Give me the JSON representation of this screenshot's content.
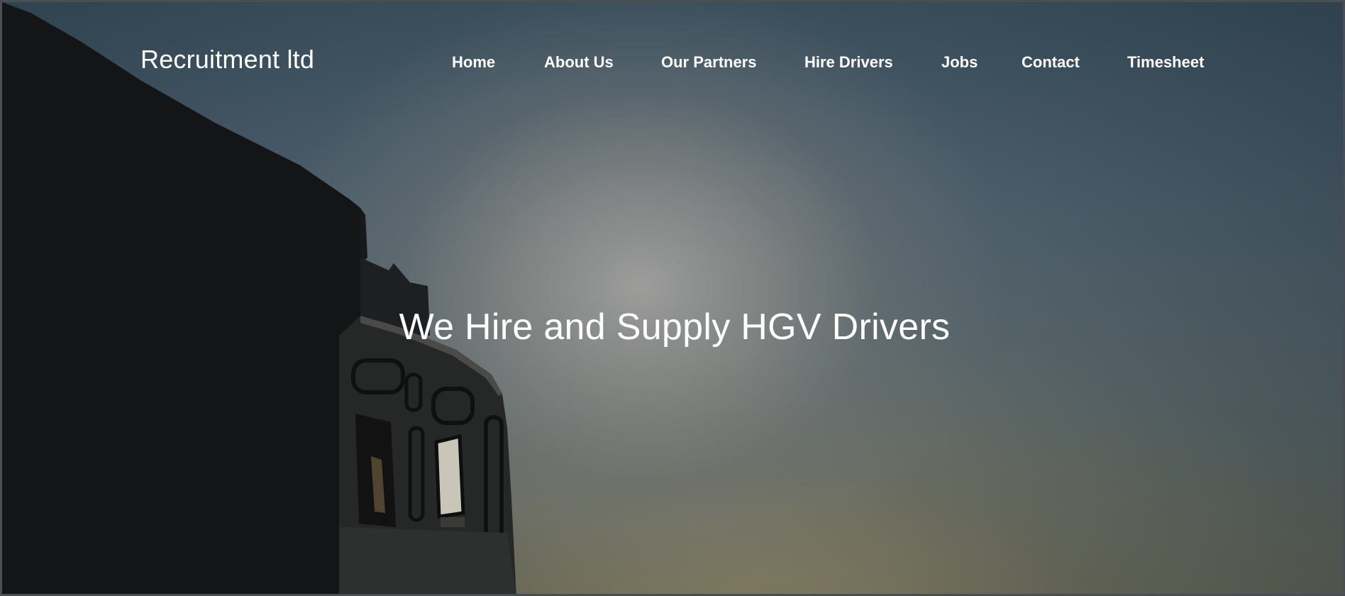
{
  "header": {
    "brand": "Recruitment ltd",
    "nav": [
      {
        "label": "Home"
      },
      {
        "label": "About Us"
      },
      {
        "label": "Our Partners"
      },
      {
        "label": "Hire Drivers"
      },
      {
        "label": "Jobs"
      },
      {
        "label": "Contact"
      },
      {
        "label": "Timesheet"
      }
    ]
  },
  "hero": {
    "heading": "We Hire and Supply HGV Drivers",
    "background_image": "silhouette-of-truck-against-evening-sky",
    "colors": {
      "sky_top": "#3d5260",
      "sky_glow": "#a0a09e",
      "horizon": "#6e6e5c",
      "silhouette": "#141516",
      "text": "#ffffff"
    }
  }
}
